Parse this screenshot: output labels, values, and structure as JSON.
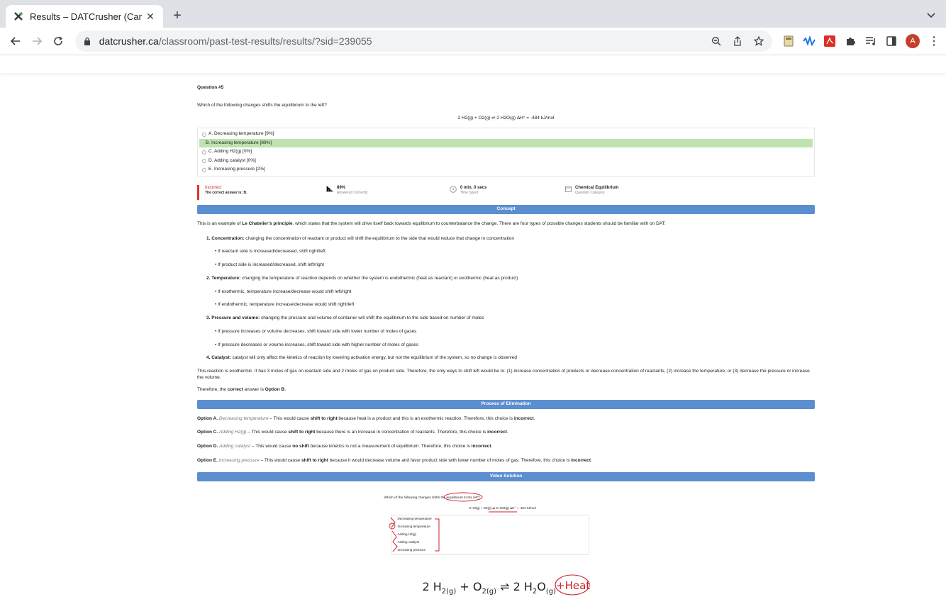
{
  "browser": {
    "tab_title": "Results – DATCrusher (Canadia",
    "url_host": "datcrusher.ca",
    "url_path": "/classroom/past-test-results/results/?sid=239055",
    "avatar_letter": "A"
  },
  "question": {
    "number": "Question #5",
    "text": "Which of the following changes shifts the equilibrium to the left?",
    "equation": "2 H2(g) + O2(g) ⇌ 2 H2O(g)  ΔH° = -484 kJ/mol",
    "options": [
      {
        "label": "A. Decreasing temperature [9%]",
        "correct": false
      },
      {
        "label": "B. Increasing temperature [89%]",
        "correct": true
      },
      {
        "label": "C. Adding H2(g) [0%]",
        "correct": false
      },
      {
        "label": "D. Adding catalyst [0%]",
        "correct": false
      },
      {
        "label": "E. Increasing pressure [2%]",
        "correct": false
      }
    ]
  },
  "stats": {
    "status": "Incorrect",
    "correct_answer": "The correct answer is: B.",
    "percent": "89%",
    "percent_label": "Answered Correctly",
    "time": "0 min, 0 secs",
    "time_label": "Time Spent",
    "category": "Chemical Equilibrium",
    "category_label": "Question Category"
  },
  "concept": {
    "header": "Concept",
    "intro_pre": "This is an example of ",
    "intro_bold": "Le Chatelier's principle",
    "intro_post": ", which states that the system will drive itself back towards equilibrium to counterbalance the change. There are four types of possible changes students should be familiar with on DAT.",
    "items": [
      {
        "title": "1. Concentration:",
        "text": " changing the concentration of reactant or product will shift the equilibrium to the side that would reduce that change in concentration",
        "subs": [
          "• If reactant side is increased/decreased, shift right/left",
          "• If product side is increased/decreased, shift left/right"
        ]
      },
      {
        "title": "2. Temperature:",
        "text": " changing the temperature of reaction depends on whether the system is endothermic (heat as reactant) or exothermic (heat as product)",
        "subs": [
          "• If exothermic, temperature increase/decrease would shift left/right",
          "• If endothermic, temperature increase/decrease would shift right/left"
        ]
      },
      {
        "title": "3. Pressure and volume:",
        "text": " changing the pressure and volume of container will shift the equilibrium to the side based on number of moles",
        "subs": [
          "• If pressure increases or volume decreases, shift toward side with lower number of moles of gases",
          "• If pressure decreases or volume increases, shift toward side with higher number of moles of gases"
        ]
      },
      {
        "title": "4. Catalyst:",
        "text": " catalyst will only affect the kinetics of reaction by lowering activation energy, but not the equilibrium of the system, so no change is observed",
        "subs": []
      }
    ],
    "reaction_text": "This reaction is exothermic. It has 3 moles of gas on reactant side and 2 moles of gas on product side. Therefore, the only ways to shift left would be to: (1) increase concentration of products or decrease concentration of reactants, (2) increase the temperature, or (3) decrease the pressure or increase the volume.",
    "conclusion_pre": "Therefore, the ",
    "conclusion_bold1": "correct",
    "conclusion_mid": " answer is ",
    "conclusion_bold2": "Option B",
    "conclusion_post": "."
  },
  "elimination": {
    "header": "Process of Elimination",
    "items": [
      {
        "label": "Option A.",
        "name": "Decreasing temperature",
        "mid": " – This would cause ",
        "effect": "shift to right",
        "rest": " because heat is a product and this is an exothermic reaction. Therefore, this choice is ",
        "verdict": "incorrect",
        "end": "."
      },
      {
        "label": "Option C.",
        "name": "Adding H2(g)",
        "mid": " – This would cause ",
        "effect": "shift to right",
        "rest": " because there is an increase in concentration of reactants. Therefore, this choice is ",
        "verdict": "incorrect",
        "end": "."
      },
      {
        "label": "Option D.",
        "name": "Adding catalyst",
        "mid": " – This would cause ",
        "effect": "no shift",
        "rest": " because kinetics is not a measurement of equilibrium. Therefore, this choice is ",
        "verdict": "incorrect",
        "end": "."
      },
      {
        "label": "Option E.",
        "name": "Increasing pressure",
        "mid": " – This would cause ",
        "effect": "shift to right",
        "rest": " because it would decrease volume and favor product side with lower number of moles of gas. Therefore, this choice is ",
        "verdict": "incorrect",
        "end": "."
      }
    ]
  },
  "video": {
    "header": "Video Solution",
    "question": "Which of the following changes shifts the equilibrium to the left?",
    "equation": "2 H2(g) + O2(g) ⇌ 2 H2O(g)  ΔH° = -484 kJ/mol",
    "options": [
      "Decreasing temperature",
      "Increasing temperature",
      "Adding H2(g)",
      "Adding catalyst",
      "Increasing pressure"
    ],
    "big_equation": "2 H2(g) + O2(g) ⇌ 2 H2O(g)",
    "annotation": "+Heat"
  },
  "colors": {
    "accent": "#5b8ecf",
    "correct_bg": "#bfe3b0",
    "incorrect": "#d62828",
    "ink": "#d0202a"
  }
}
